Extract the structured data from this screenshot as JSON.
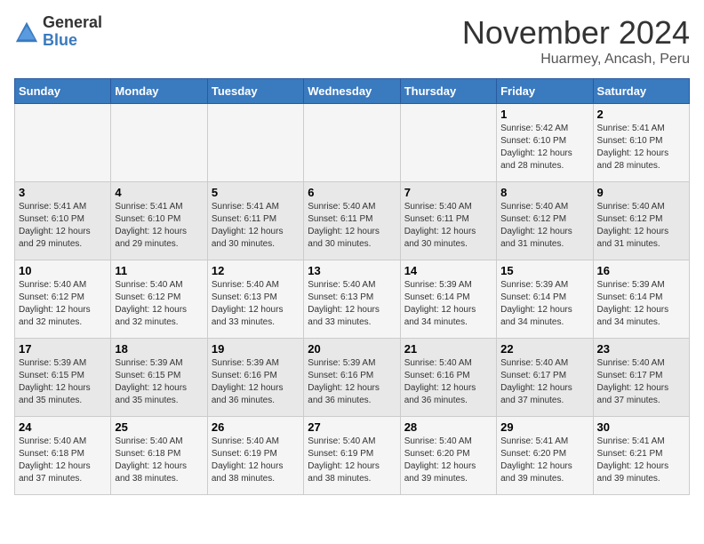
{
  "logo": {
    "general": "General",
    "blue": "Blue"
  },
  "title": "November 2024",
  "location": "Huarmey, Ancash, Peru",
  "days_of_week": [
    "Sunday",
    "Monday",
    "Tuesday",
    "Wednesday",
    "Thursday",
    "Friday",
    "Saturday"
  ],
  "weeks": [
    [
      {
        "day": "",
        "info": ""
      },
      {
        "day": "",
        "info": ""
      },
      {
        "day": "",
        "info": ""
      },
      {
        "day": "",
        "info": ""
      },
      {
        "day": "",
        "info": ""
      },
      {
        "day": "1",
        "info": "Sunrise: 5:42 AM\nSunset: 6:10 PM\nDaylight: 12 hours and 28 minutes."
      },
      {
        "day": "2",
        "info": "Sunrise: 5:41 AM\nSunset: 6:10 PM\nDaylight: 12 hours and 28 minutes."
      }
    ],
    [
      {
        "day": "3",
        "info": "Sunrise: 5:41 AM\nSunset: 6:10 PM\nDaylight: 12 hours and 29 minutes."
      },
      {
        "day": "4",
        "info": "Sunrise: 5:41 AM\nSunset: 6:10 PM\nDaylight: 12 hours and 29 minutes."
      },
      {
        "day": "5",
        "info": "Sunrise: 5:41 AM\nSunset: 6:11 PM\nDaylight: 12 hours and 30 minutes."
      },
      {
        "day": "6",
        "info": "Sunrise: 5:40 AM\nSunset: 6:11 PM\nDaylight: 12 hours and 30 minutes."
      },
      {
        "day": "7",
        "info": "Sunrise: 5:40 AM\nSunset: 6:11 PM\nDaylight: 12 hours and 30 minutes."
      },
      {
        "day": "8",
        "info": "Sunrise: 5:40 AM\nSunset: 6:12 PM\nDaylight: 12 hours and 31 minutes."
      },
      {
        "day": "9",
        "info": "Sunrise: 5:40 AM\nSunset: 6:12 PM\nDaylight: 12 hours and 31 minutes."
      }
    ],
    [
      {
        "day": "10",
        "info": "Sunrise: 5:40 AM\nSunset: 6:12 PM\nDaylight: 12 hours and 32 minutes."
      },
      {
        "day": "11",
        "info": "Sunrise: 5:40 AM\nSunset: 6:12 PM\nDaylight: 12 hours and 32 minutes."
      },
      {
        "day": "12",
        "info": "Sunrise: 5:40 AM\nSunset: 6:13 PM\nDaylight: 12 hours and 33 minutes."
      },
      {
        "day": "13",
        "info": "Sunrise: 5:40 AM\nSunset: 6:13 PM\nDaylight: 12 hours and 33 minutes."
      },
      {
        "day": "14",
        "info": "Sunrise: 5:39 AM\nSunset: 6:14 PM\nDaylight: 12 hours and 34 minutes."
      },
      {
        "day": "15",
        "info": "Sunrise: 5:39 AM\nSunset: 6:14 PM\nDaylight: 12 hours and 34 minutes."
      },
      {
        "day": "16",
        "info": "Sunrise: 5:39 AM\nSunset: 6:14 PM\nDaylight: 12 hours and 34 minutes."
      }
    ],
    [
      {
        "day": "17",
        "info": "Sunrise: 5:39 AM\nSunset: 6:15 PM\nDaylight: 12 hours and 35 minutes."
      },
      {
        "day": "18",
        "info": "Sunrise: 5:39 AM\nSunset: 6:15 PM\nDaylight: 12 hours and 35 minutes."
      },
      {
        "day": "19",
        "info": "Sunrise: 5:39 AM\nSunset: 6:16 PM\nDaylight: 12 hours and 36 minutes."
      },
      {
        "day": "20",
        "info": "Sunrise: 5:39 AM\nSunset: 6:16 PM\nDaylight: 12 hours and 36 minutes."
      },
      {
        "day": "21",
        "info": "Sunrise: 5:40 AM\nSunset: 6:16 PM\nDaylight: 12 hours and 36 minutes."
      },
      {
        "day": "22",
        "info": "Sunrise: 5:40 AM\nSunset: 6:17 PM\nDaylight: 12 hours and 37 minutes."
      },
      {
        "day": "23",
        "info": "Sunrise: 5:40 AM\nSunset: 6:17 PM\nDaylight: 12 hours and 37 minutes."
      }
    ],
    [
      {
        "day": "24",
        "info": "Sunrise: 5:40 AM\nSunset: 6:18 PM\nDaylight: 12 hours and 37 minutes."
      },
      {
        "day": "25",
        "info": "Sunrise: 5:40 AM\nSunset: 6:18 PM\nDaylight: 12 hours and 38 minutes."
      },
      {
        "day": "26",
        "info": "Sunrise: 5:40 AM\nSunset: 6:19 PM\nDaylight: 12 hours and 38 minutes."
      },
      {
        "day": "27",
        "info": "Sunrise: 5:40 AM\nSunset: 6:19 PM\nDaylight: 12 hours and 38 minutes."
      },
      {
        "day": "28",
        "info": "Sunrise: 5:40 AM\nSunset: 6:20 PM\nDaylight: 12 hours and 39 minutes."
      },
      {
        "day": "29",
        "info": "Sunrise: 5:41 AM\nSunset: 6:20 PM\nDaylight: 12 hours and 39 minutes."
      },
      {
        "day": "30",
        "info": "Sunrise: 5:41 AM\nSunset: 6:21 PM\nDaylight: 12 hours and 39 minutes."
      }
    ]
  ]
}
